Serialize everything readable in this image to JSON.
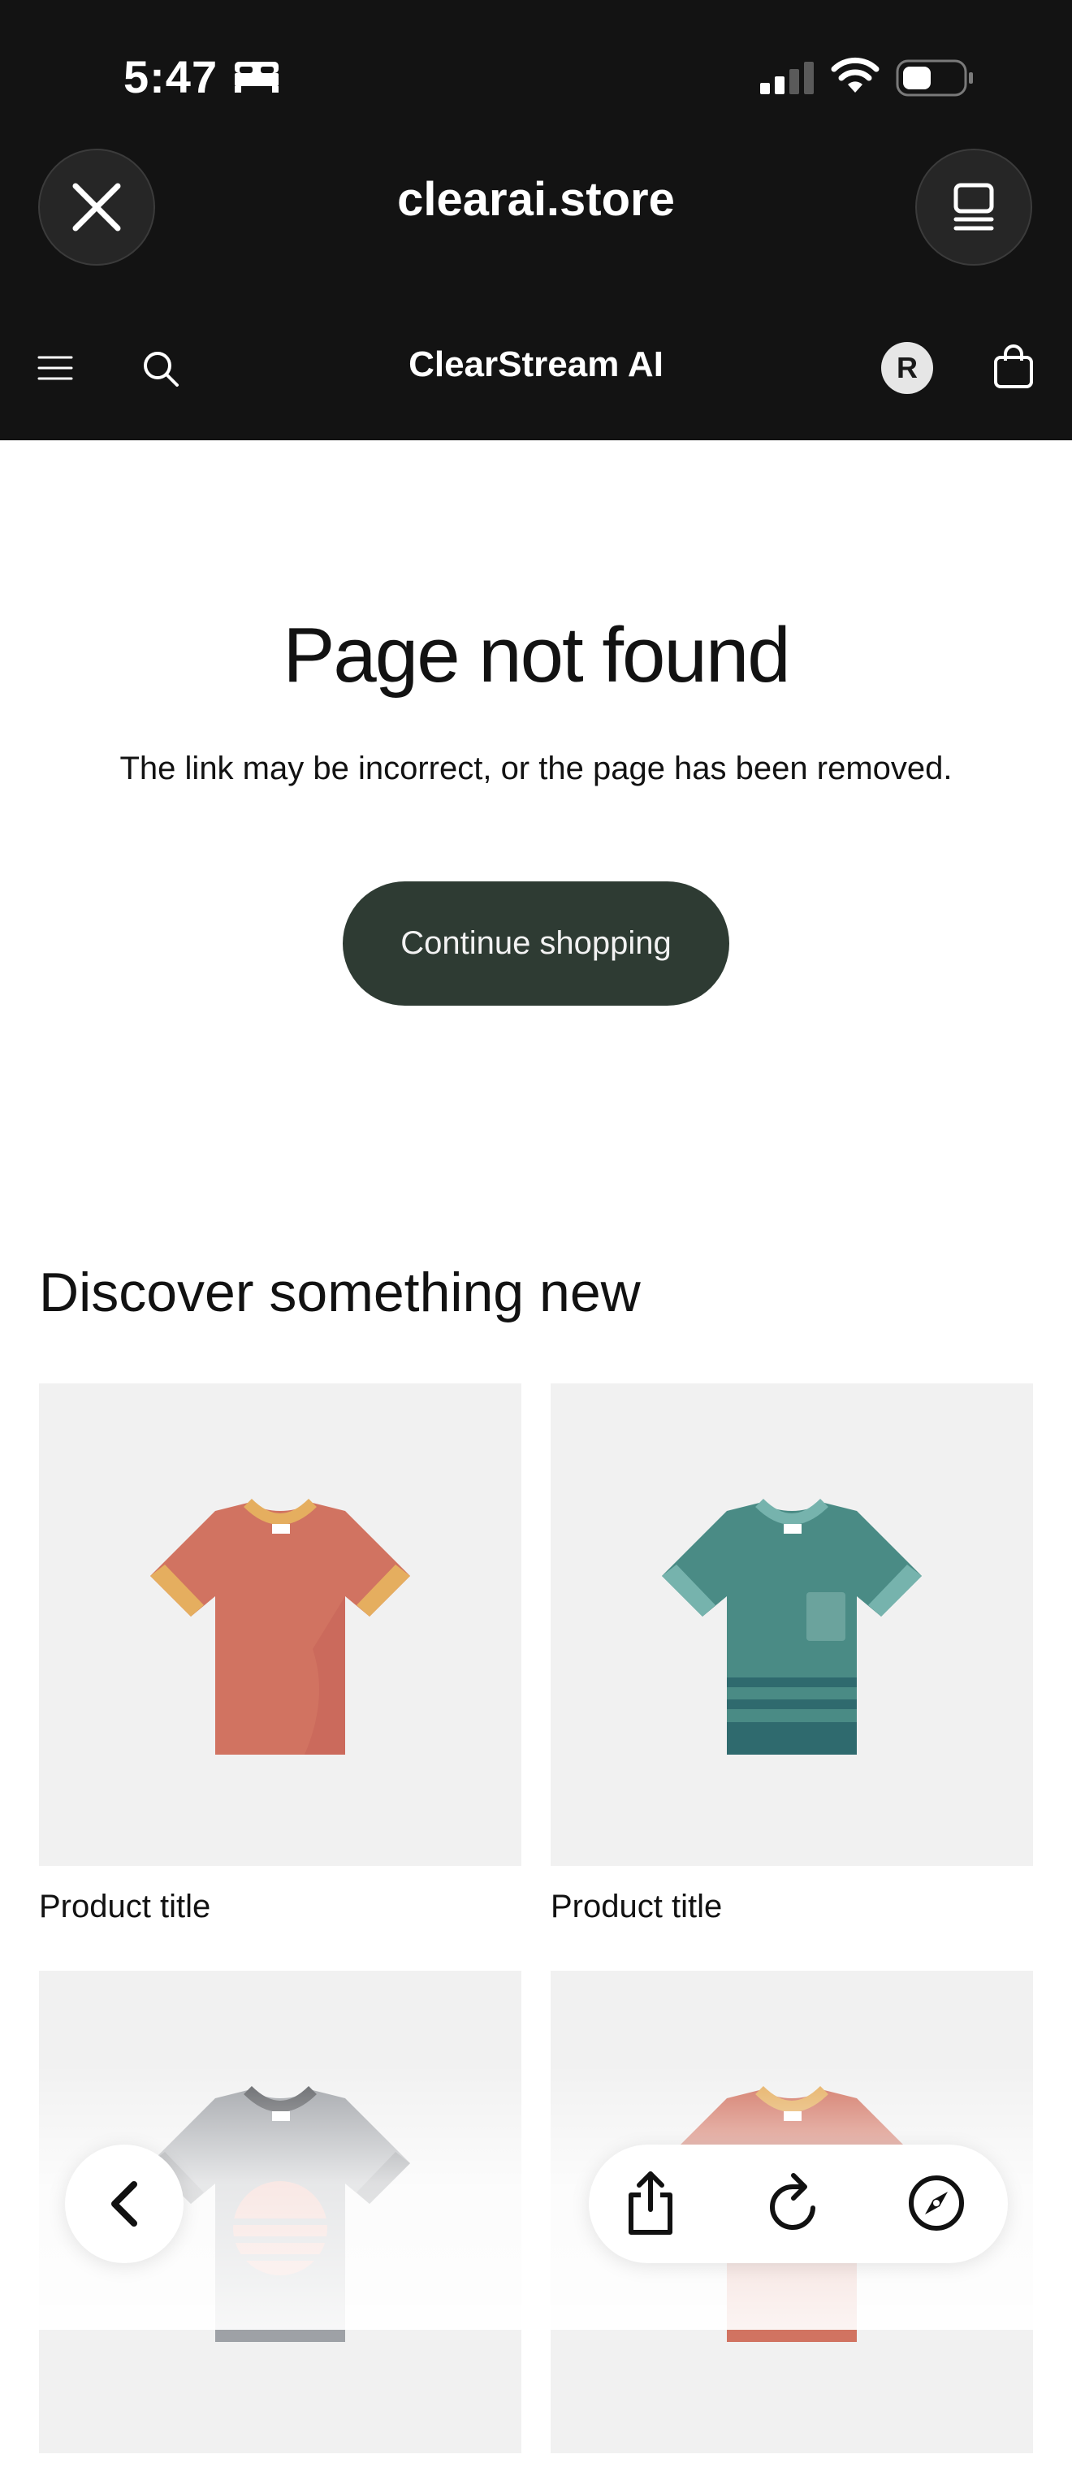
{
  "status_bar": {
    "time": "5:47",
    "focus_icon": "bed-icon",
    "signal_icon": "cellular-signal-icon",
    "wifi_icon": "wifi-icon",
    "battery_icon": "battery-icon"
  },
  "browser": {
    "url_title": "clearai.store",
    "close_icon": "close-icon",
    "tabs_icon": "tabs-icon"
  },
  "store_header": {
    "store_name": "ClearStream AI",
    "avatar_initial": "R",
    "menu_icon": "hamburger-menu-icon",
    "search_icon": "search-icon",
    "cart_icon": "shopping-bag-icon"
  },
  "not_found": {
    "title": "Page not found",
    "description": "The link may be incorrect, or the page has been removed.",
    "button_label": "Continue shopping"
  },
  "discover": {
    "title": "Discover something new",
    "products": [
      {
        "title": "Product title",
        "image": "orange-tshirt"
      },
      {
        "title": "Product title",
        "image": "teal-striped-tshirt"
      },
      {
        "title": "",
        "image": "gray-sunset-tshirt"
      },
      {
        "title": "",
        "image": "orange-tshirt"
      }
    ]
  },
  "toolbar": {
    "back_icon": "chevron-left-icon",
    "share_icon": "share-icon",
    "reload_icon": "reload-icon",
    "compass_icon": "compass-icon"
  },
  "colors": {
    "header_bg": "#131313",
    "button_bg": "#2e3b33",
    "card_bg": "#f1f1f1"
  }
}
